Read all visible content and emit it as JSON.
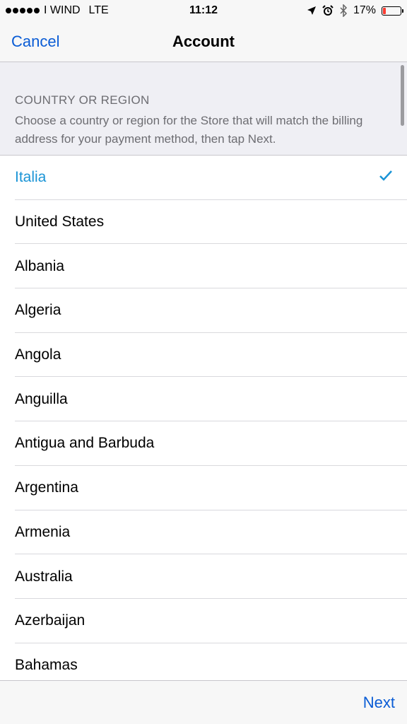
{
  "status_bar": {
    "carrier": "I WIND",
    "network": "LTE",
    "time": "11:12",
    "battery_percent": "17%",
    "battery_level": 0.17,
    "icons": [
      "signal-dots-icon",
      "location-arrow-icon",
      "alarm-icon",
      "bluetooth-icon",
      "battery-icon"
    ]
  },
  "nav": {
    "cancel": "Cancel",
    "title": "Account"
  },
  "section": {
    "title": "COUNTRY OR REGION",
    "description": "Choose a country or region for the Store that will match the billing address for your payment method, then tap Next."
  },
  "countries": [
    {
      "label": "Italia",
      "selected": true
    },
    {
      "label": "United States"
    },
    {
      "label": "Albania"
    },
    {
      "label": "Algeria"
    },
    {
      "label": "Angola"
    },
    {
      "label": "Anguilla"
    },
    {
      "label": "Antigua and Barbuda"
    },
    {
      "label": "Argentina"
    },
    {
      "label": "Armenia"
    },
    {
      "label": "Australia"
    },
    {
      "label": "Azerbaijan"
    },
    {
      "label": "Bahamas"
    }
  ],
  "toolbar": {
    "next": "Next"
  },
  "colors": {
    "link_blue": "#0a5cd5",
    "selected_blue": "#1a94d6",
    "battery_red": "#ff3b30"
  }
}
